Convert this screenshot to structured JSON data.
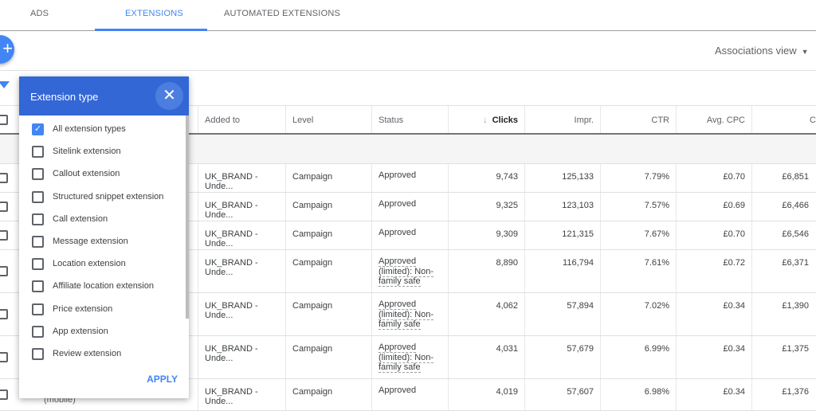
{
  "tabs": [
    {
      "label": "ADS"
    },
    {
      "label": "EXTENSIONS",
      "active": true
    },
    {
      "label": "AUTOMATED EXTENSIONS"
    }
  ],
  "fab": {
    "icon": "plus-icon",
    "label": "+"
  },
  "view_selector": {
    "label": "Associations view",
    "icon": "caret-down-icon"
  },
  "filter_icon": "filter-icon",
  "accent": "#4285f4",
  "dialog": {
    "title": "Extension type",
    "close": "✕",
    "apply": "APPLY",
    "header_color": "#3367d6",
    "options": [
      {
        "label": "All extension types",
        "checked": true
      },
      {
        "label": "Sitelink extension",
        "checked": false
      },
      {
        "label": "Callout extension",
        "checked": false
      },
      {
        "label": "Structured snippet extension",
        "checked": false
      },
      {
        "label": "Call extension",
        "checked": false
      },
      {
        "label": "Message extension",
        "checked": false
      },
      {
        "label": "Location extension",
        "checked": false
      },
      {
        "label": "Affiliate location extension",
        "checked": false
      },
      {
        "label": "Price extension",
        "checked": false
      },
      {
        "label": "App extension",
        "checked": false
      },
      {
        "label": "Review extension",
        "checked": false
      }
    ]
  },
  "table": {
    "columns": [
      "Added to",
      "Level",
      "Status",
      "Clicks",
      "Impr.",
      "CTR",
      "Avg. CPC",
      "C"
    ],
    "sort_icon": "↓",
    "rows": [
      {
        "added_to": "UK_BRAND - Unde...",
        "level": "Campaign",
        "status": "Approved",
        "clicks": "9,743",
        "impr": "125,133",
        "ctr": "7.79%",
        "cpc": "£0.70",
        "cost": "£6,851"
      },
      {
        "added_to": "UK_BRAND - Unde...",
        "level": "Campaign",
        "status": "Approved",
        "clicks": "9,325",
        "impr": "123,103",
        "ctr": "7.57%",
        "cpc": "£0.69",
        "cost": "£6,466"
      },
      {
        "added_to": "UK_BRAND - Unde...",
        "level": "Campaign",
        "status": "Approved",
        "clicks": "9,309",
        "impr": "121,315",
        "ctr": "7.67%",
        "cpc": "£0.70",
        "cost": "£6,546"
      },
      {
        "added_to": "UK_BRAND - Unde...",
        "level": "Campaign",
        "status": "Approved (limited): Non-family safe",
        "clicks": "8,890",
        "impr": "116,794",
        "ctr": "7.61%",
        "cpc": "£0.72",
        "cost": "£6,371"
      },
      {
        "added_to": "UK_BRAND - Unde...",
        "level": "Campaign",
        "status": "Approved (limited): Non-family safe",
        "clicks": "4,062",
        "impr": "57,894",
        "ctr": "7.02%",
        "cpc": "£0.34",
        "cost": "£1,390"
      },
      {
        "added_to": "UK_BRAND - Unde...",
        "level": "Campaign",
        "status": "Approved (limited): Non-family safe",
        "clicks": "4,031",
        "impr": "57,679",
        "ctr": "6.99%",
        "cpc": "£0.34",
        "cost": "£1,375"
      },
      {
        "added_to": "UK_BRAND - Unde...",
        "level": "Campaign",
        "status": "Approved",
        "clicks": "4,019",
        "impr": "57,607",
        "ctr": "6.98%",
        "cpc": "£0.34",
        "cost": "£1,376"
      }
    ],
    "partial_text": "(mobile)"
  }
}
